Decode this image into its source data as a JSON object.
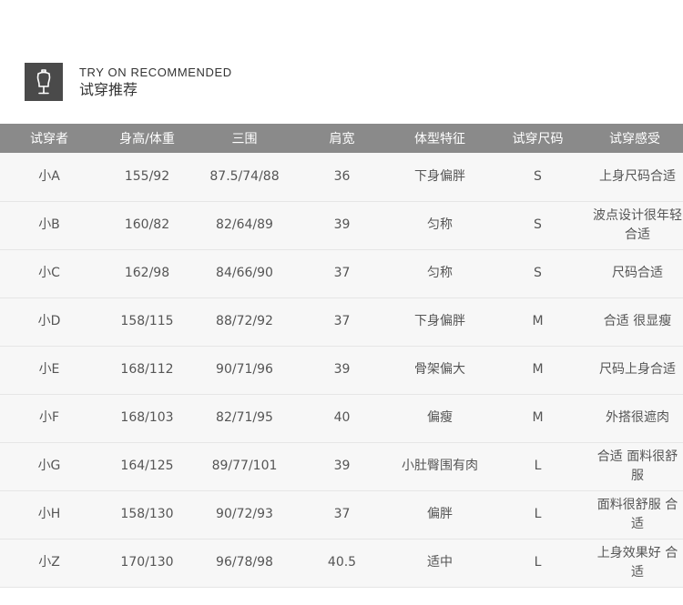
{
  "header": {
    "en_title": "TRY ON RECOMMENDED",
    "cn_title": "试穿推荐",
    "icon": "mannequin-icon"
  },
  "table": {
    "columns": [
      "试穿者",
      "身高/体重",
      "三围",
      "肩宽",
      "体型特征",
      "试穿尺码",
      "试穿感受"
    ],
    "rows": [
      [
        "小A",
        "155/92",
        "87.5/74/88",
        "36",
        "下身偏胖",
        "S",
        "上身尺码合适"
      ],
      [
        "小B",
        "160/82",
        "82/64/89",
        "39",
        "匀称",
        "S",
        "波点设计很年轻合适"
      ],
      [
        "小C",
        "162/98",
        "84/66/90",
        "37",
        "匀称",
        "S",
        "尺码合适"
      ],
      [
        "小D",
        "158/115",
        "88/72/92",
        "37",
        "下身偏胖",
        "M",
        "合适 很显瘦"
      ],
      [
        "小E",
        "168/112",
        "90/71/96",
        "39",
        "骨架偏大",
        "M",
        "尺码上身合适"
      ],
      [
        "小F",
        "168/103",
        "82/71/95",
        "40",
        "偏瘦",
        "M",
        "外搭很遮肉"
      ],
      [
        "小G",
        "164/125",
        "89/77/101",
        "39",
        "小肚臀围有肉",
        "L",
        "合适 面料很舒服"
      ],
      [
        "小H",
        "158/130",
        "90/72/93",
        "37",
        "偏胖",
        "L",
        "面料很舒服 合适"
      ],
      [
        "小Z",
        "170/130",
        "96/78/98",
        "40.5",
        "适中",
        "L",
        "上身效果好 合适"
      ]
    ]
  }
}
